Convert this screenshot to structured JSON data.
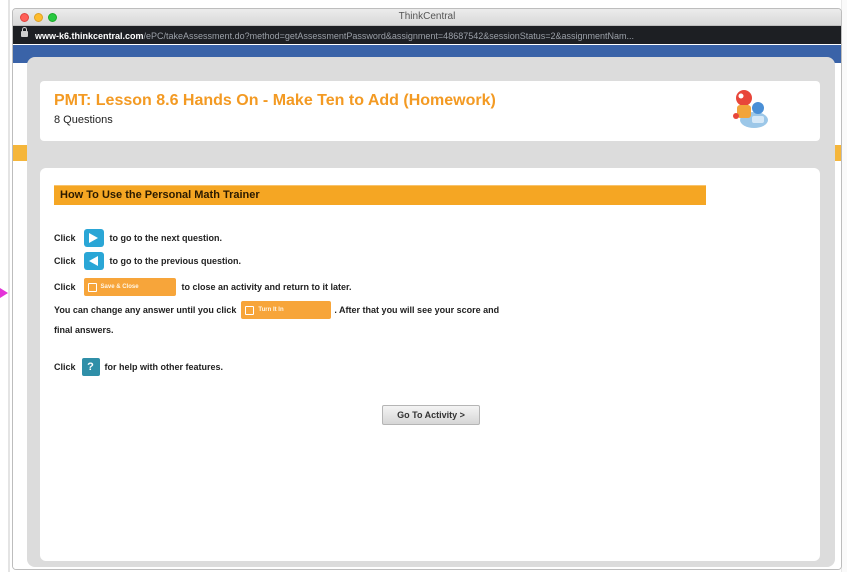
{
  "window": {
    "title": "ThinkCentral"
  },
  "addressbar": {
    "host": "www-k6.thinkcentral.com",
    "path": "/ePC/takeAssessment.do?method=getAssessmentPassword&assignment=48687542&sessionStatus=2&assignmentNam..."
  },
  "header": {
    "title": "PMT: Lesson 8.6 Hands On - Make Ten to Add (Homework)",
    "subtitle": "8 Questions",
    "icon": "personal-math-trainer-icon"
  },
  "instructions": {
    "heading": "How To Use the Personal Math Trainer",
    "line1": {
      "prefix": "Click",
      "suffix": "to go to the next question.",
      "icon": "arrow-right-icon"
    },
    "line2": {
      "prefix": "Click",
      "suffix": "to go to the previous question.",
      "icon": "arrow-left-icon"
    },
    "line3": {
      "prefix": "Click",
      "button_label": "Save & Close",
      "suffix": "to close an activity and return to it later."
    },
    "line4": {
      "prefix": "You can change any answer until you click",
      "button_label": "Turn It In",
      "suffix": ". After that you will see your score and"
    },
    "line5": {
      "text": "final answers."
    },
    "line6": {
      "prefix": "Click",
      "help_symbol": "?",
      "suffix": "for help with other features."
    }
  },
  "actions": {
    "go_to_activity": "Go To Activity >"
  },
  "colors": {
    "accent_orange": "#f5a623",
    "title_orange": "#f39a23",
    "nav_blue": "#2aa6d6",
    "band_blue": "#3a63a8"
  }
}
